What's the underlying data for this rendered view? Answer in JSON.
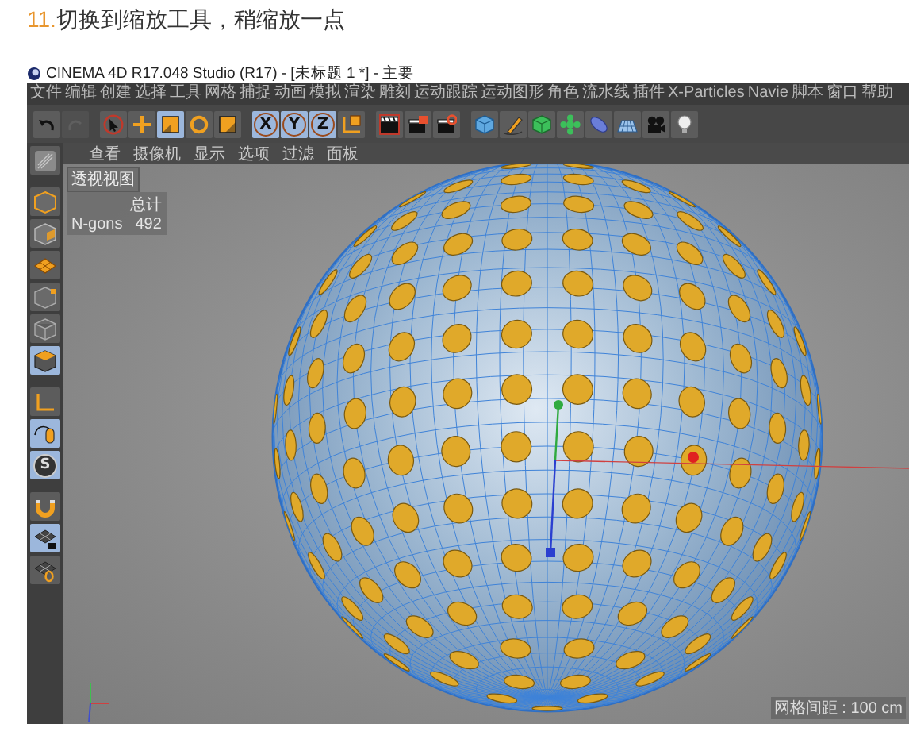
{
  "heading": {
    "number": "11.",
    "text": "切换到缩放工具，稍缩放一点"
  },
  "window": {
    "title": "CINEMA 4D R17.048 Studio (R17) - [未标题 1 *] - 主要"
  },
  "menu": [
    "文件",
    "编辑",
    "创建",
    "选择",
    "工具",
    "网格",
    "捕捉",
    "动画",
    "模拟",
    "渲染",
    "雕刻",
    "运动跟踪",
    "运动图形",
    "角色",
    "流水线",
    "插件",
    "X-Particles",
    "Navie",
    "脚本",
    "窗口",
    "帮助"
  ],
  "toolbar": [
    {
      "kind": "undo",
      "selected": false,
      "disabled": false
    },
    {
      "kind": "redo",
      "selected": false,
      "disabled": true
    },
    {
      "kind": "select",
      "selected": false,
      "disabled": false
    },
    {
      "kind": "move",
      "selected": false,
      "disabled": false
    },
    {
      "kind": "scale",
      "selected": true,
      "disabled": false
    },
    {
      "kind": "rotate",
      "selected": false,
      "disabled": false
    },
    {
      "kind": "recent",
      "selected": false,
      "disabled": false
    },
    {
      "kind": "axis",
      "label": "X",
      "selected": true,
      "disabled": false
    },
    {
      "kind": "axis",
      "label": "Y",
      "selected": true,
      "disabled": false
    },
    {
      "kind": "axis",
      "label": "Z",
      "selected": true,
      "disabled": false
    },
    {
      "kind": "coords",
      "selected": false,
      "disabled": false
    },
    {
      "kind": "render-view",
      "selected": false,
      "disabled": false
    },
    {
      "kind": "render",
      "selected": false,
      "disabled": false
    },
    {
      "kind": "render-settings",
      "selected": false,
      "disabled": false
    },
    {
      "kind": "cube",
      "selected": false,
      "disabled": false
    },
    {
      "kind": "pen",
      "selected": false,
      "disabled": false
    },
    {
      "kind": "subdivide",
      "selected": false,
      "disabled": false
    },
    {
      "kind": "cloner",
      "selected": false,
      "disabled": false
    },
    {
      "kind": "deformer",
      "selected": false,
      "disabled": false
    },
    {
      "kind": "floor",
      "selected": false,
      "disabled": false
    },
    {
      "kind": "camera",
      "selected": false,
      "disabled": false
    },
    {
      "kind": "light",
      "selected": false,
      "disabled": false
    }
  ],
  "palette": [
    {
      "kind": "editable",
      "selected": false
    },
    {
      "kind": "model",
      "selected": false
    },
    {
      "kind": "texture",
      "selected": false
    },
    {
      "kind": "workplane",
      "selected": false
    },
    {
      "kind": "points",
      "selected": false
    },
    {
      "kind": "edges",
      "selected": false
    },
    {
      "kind": "polygons",
      "selected": true
    },
    {
      "kind": "axis-mode",
      "selected": false
    },
    {
      "kind": "tweak",
      "selected": true
    },
    {
      "kind": "snap",
      "label": "S",
      "selected": true
    },
    {
      "kind": "magnet",
      "selected": false
    },
    {
      "kind": "lock-plane",
      "selected": true
    },
    {
      "kind": "plane-axis",
      "selected": false
    }
  ],
  "viewport": {
    "menu": [
      "查看",
      "摄像机",
      "显示",
      "选项",
      "过滤",
      "面板"
    ],
    "view_label": "透视视图",
    "hud": {
      "header": "总计",
      "rows": [
        {
          "label": "N-gons",
          "value": "492"
        }
      ]
    },
    "grid_spacing": "网格间距 : 100 cm"
  }
}
